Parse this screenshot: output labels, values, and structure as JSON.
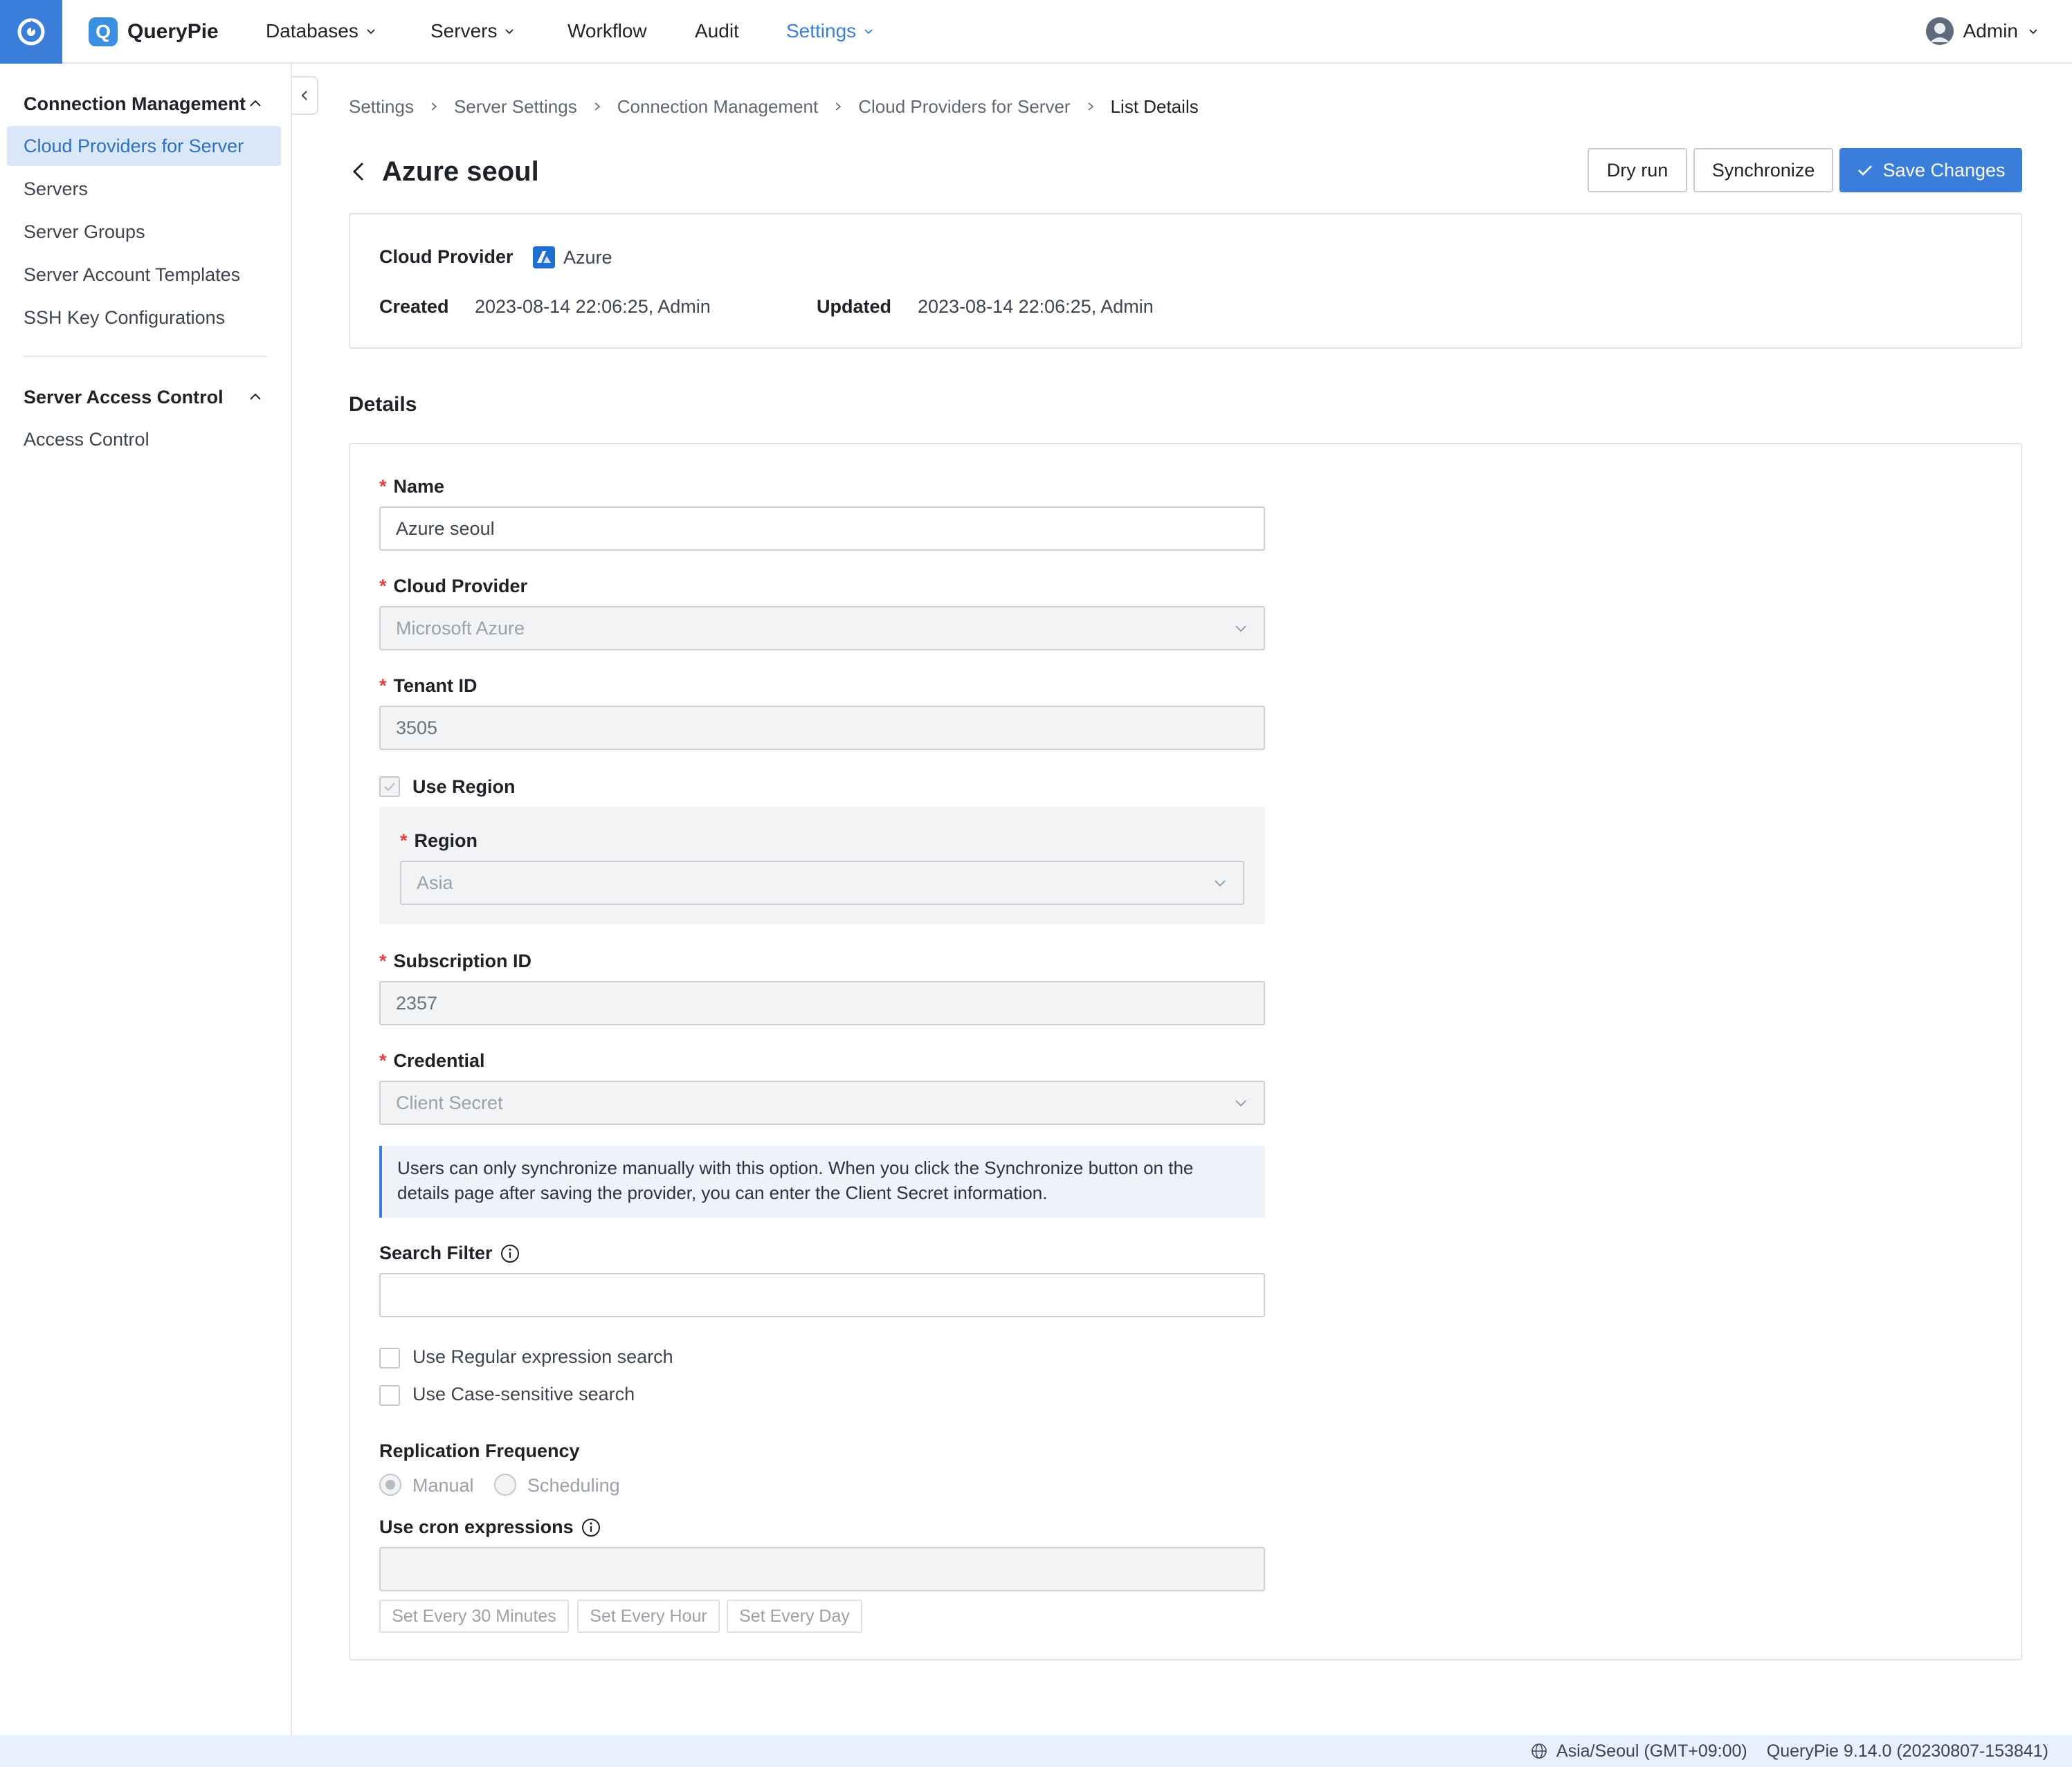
{
  "topbar": {
    "brand": "QueryPie",
    "brand_letter": "Q",
    "nav": [
      {
        "label": "Databases",
        "has_dropdown": true
      },
      {
        "label": "Servers",
        "has_dropdown": true
      },
      {
        "label": "Workflow",
        "has_dropdown": false
      },
      {
        "label": "Audit",
        "has_dropdown": false
      },
      {
        "label": "Settings",
        "has_dropdown": true,
        "active": true
      }
    ],
    "user": "Admin"
  },
  "sidebar": {
    "groups": [
      {
        "title": "Connection Management",
        "expanded": true,
        "items": [
          {
            "label": "Cloud Providers for Server",
            "active": true
          },
          {
            "label": "Servers"
          },
          {
            "label": "Server Groups"
          },
          {
            "label": "Server Account Templates"
          },
          {
            "label": "SSH Key Configurations"
          }
        ]
      },
      {
        "title": "Server Access Control",
        "expanded": true,
        "items": [
          {
            "label": "Access Control"
          }
        ]
      }
    ]
  },
  "breadcrumb": [
    "Settings",
    "Server Settings",
    "Connection Management",
    "Cloud Providers for Server",
    "List Details"
  ],
  "page": {
    "title": "Azure seoul",
    "buttons": {
      "dry_run": "Dry run",
      "synchronize": "Synchronize",
      "save": "Save Changes"
    }
  },
  "summary": {
    "cloud_provider_label": "Cloud Provider",
    "cloud_provider_value": "Azure",
    "created_label": "Created",
    "created_value": "2023-08-14 22:06:25, Admin",
    "updated_label": "Updated",
    "updated_value": "2023-08-14 22:06:25, Admin"
  },
  "details": {
    "section_title": "Details",
    "name": {
      "label": "Name",
      "value": "Azure seoul"
    },
    "cloud_provider": {
      "label": "Cloud Provider",
      "value": "Microsoft Azure"
    },
    "tenant_id": {
      "label": "Tenant ID",
      "value": "3505"
    },
    "use_region": {
      "label": "Use Region",
      "checked": true
    },
    "region": {
      "label": "Region",
      "value": "Asia"
    },
    "subscription_id": {
      "label": "Subscription ID",
      "value": "2357"
    },
    "credential": {
      "label": "Credential",
      "value": "Client Secret"
    },
    "credential_note": "Users can only synchronize manually with this option. When you click the Synchronize button on the details page after saving the provider, you can enter the Client Secret information.",
    "search_filter": {
      "label": "Search Filter",
      "value": ""
    },
    "use_regex": {
      "label": "Use Regular expression search",
      "checked": false
    },
    "use_case_sensitive": {
      "label": "Use Case-sensitive search",
      "checked": false
    },
    "replication": {
      "label": "Replication Frequency",
      "options": [
        "Manual",
        "Scheduling"
      ],
      "selected": "Manual"
    },
    "cron": {
      "label": "Use cron expressions",
      "value": "",
      "presets": [
        "Set Every 30 Minutes",
        "Set Every Hour",
        "Set Every Day"
      ]
    }
  },
  "footer": {
    "timezone": "Asia/Seoul (GMT+09:00)",
    "version": "QueryPie 9.14.0 (20230807-153841)"
  },
  "colors": {
    "accent": "#3a7ed9",
    "sidebar_active_bg": "#d9e7f8",
    "required": "#e0463c",
    "footer_bg": "#e8f1fb"
  }
}
